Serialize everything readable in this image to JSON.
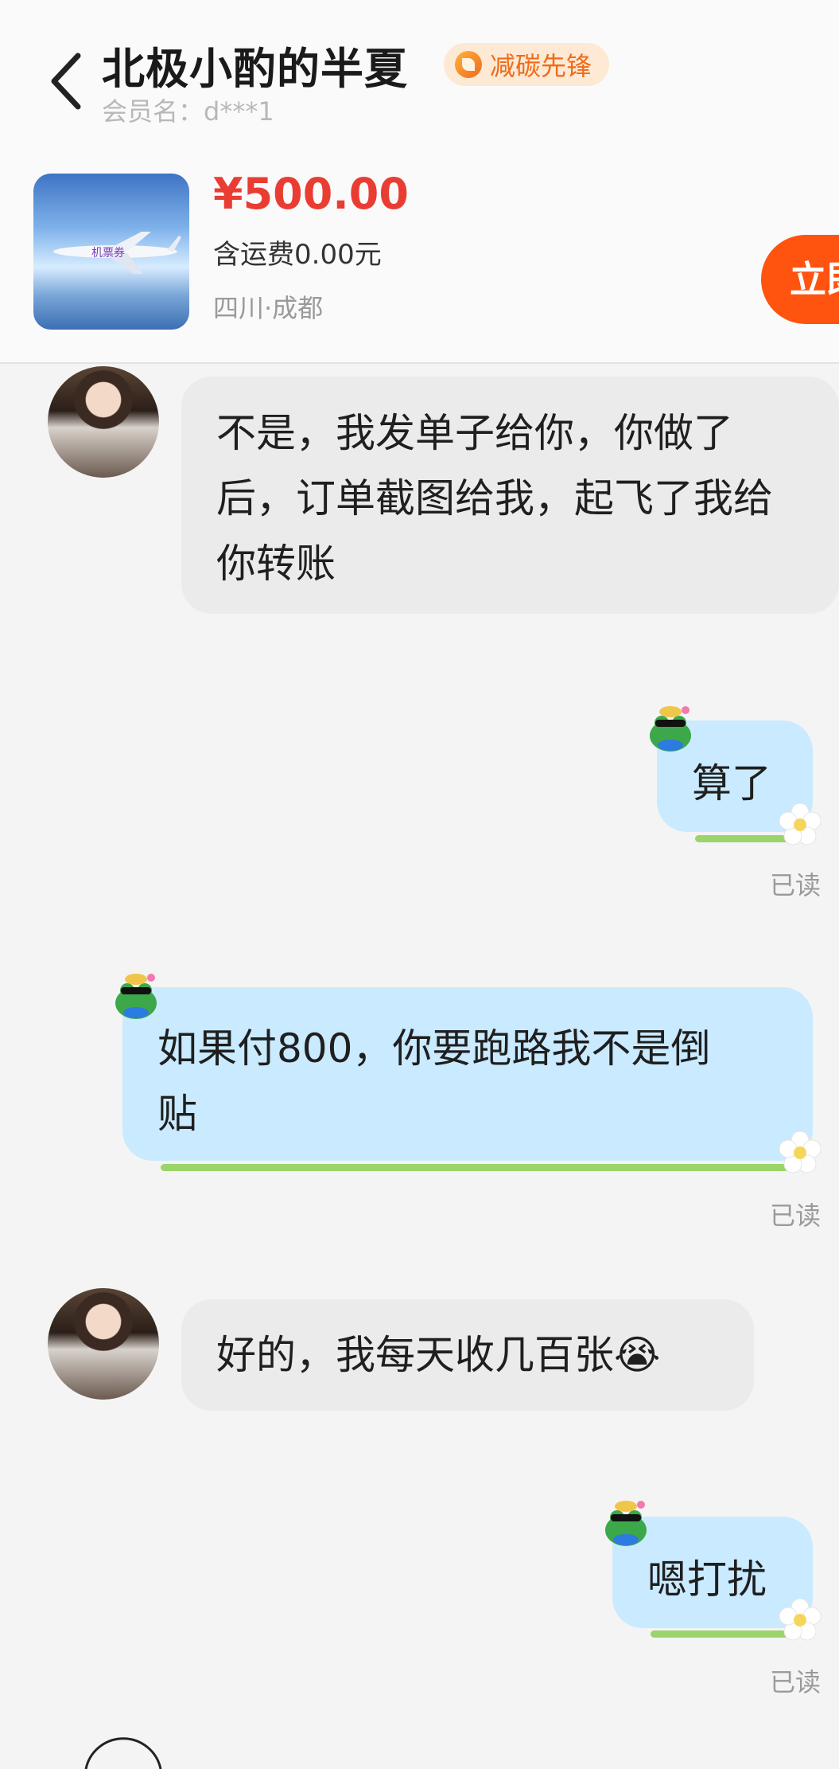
{
  "header": {
    "seller_name": "北极小酌的半夏",
    "badge_label": "减碳先锋",
    "member_label": "会员名：d***1"
  },
  "product": {
    "image_text": "机票券",
    "price": "¥500.00",
    "shipping": "含运费0.00元",
    "location": "四川·成都",
    "buy_label": "立即"
  },
  "messages": [
    {
      "side": "in",
      "lines": [
        "不是，我发单子给你，你做了",
        "后，订单截图给我，起飞了我给",
        "你转账"
      ]
    },
    {
      "side": "out",
      "text": "算了",
      "status": "已读"
    },
    {
      "side": "out",
      "lines": [
        "如果付800，你要跑路我不是倒",
        "贴"
      ],
      "status": "已读"
    },
    {
      "side": "in",
      "text": "好的，我每天收几百张😭"
    },
    {
      "side": "out",
      "text": "嗯打扰",
      "status": "已读"
    }
  ],
  "colors": {
    "price_red": "#e93d33",
    "buy_orange": "#ff5310",
    "bubble_out": "#c9eaff",
    "bubble_in": "#ebebeb",
    "badge_text": "#ef6b1a"
  }
}
